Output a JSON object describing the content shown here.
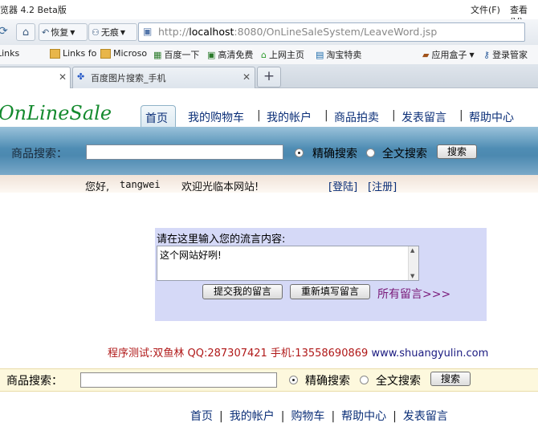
{
  "browser": {
    "window_title": "览器 4.2 Beta版",
    "menu": [
      "文件(F)",
      "查看(V)"
    ],
    "nav": {
      "restore_label": "恢复",
      "incognito_label": "无痕"
    },
    "address": {
      "prefix": "http://",
      "host": "localhost",
      "rest": ":8080/OnLineSaleSystem/LeaveWord.jsp"
    },
    "favorites": [
      "Links",
      "Links fo",
      "Microso",
      "百度一下",
      "高清免费",
      "上网主页",
      "淘宝特卖"
    ],
    "favorites_right": [
      "应用盒子",
      "登录管家"
    ],
    "tabs": [
      {
        "label": ""
      },
      {
        "label": "百度图片搜索_手机"
      }
    ]
  },
  "site": {
    "logo": "OnLineSale",
    "nav": [
      "首页",
      "我的购物车",
      "我的帐户",
      "商品拍卖",
      "发表留言",
      "帮助中心"
    ],
    "search": {
      "label": "商品搜索：",
      "exact": "精确搜索",
      "fulltext": "全文搜索",
      "button": "搜索"
    },
    "welcome": {
      "greeting": "您好,",
      "user": "tangwei",
      "message": "欢迎光临本网站!",
      "login": "[登陆]",
      "register": "[注册]"
    },
    "message": {
      "prompt": "请在这里输入您的流言内容:",
      "content": "这个网站好咧!",
      "submit": "提交我的留言",
      "reset": "重新填写留言",
      "all_link": "所有留言>>>"
    },
    "credit": {
      "text": "程序测试:双鱼林 QQ:287307421 手机:13558690869",
      "site": "www.shuangyulin.com"
    },
    "footer_nav": [
      "首页",
      "我的帐户",
      "购物车",
      "帮助中心",
      "发表留言"
    ]
  }
}
